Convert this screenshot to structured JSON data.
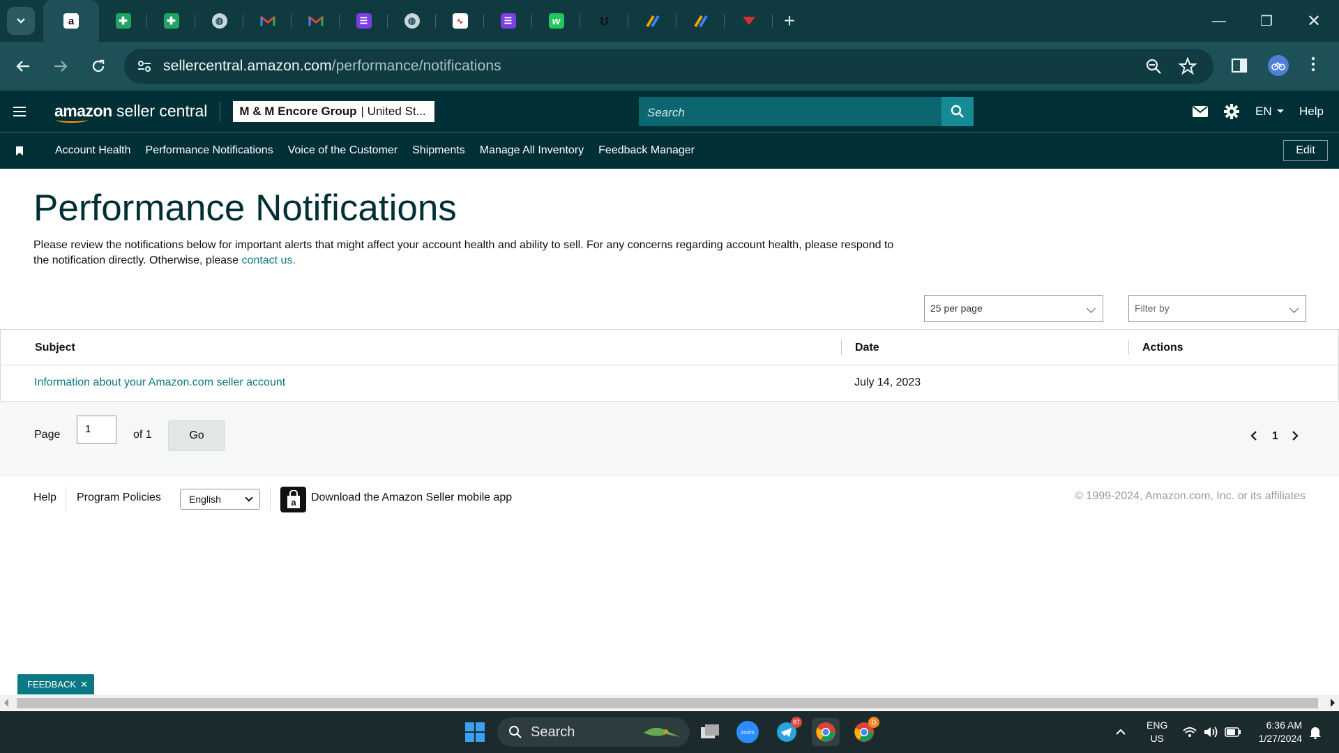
{
  "browser": {
    "tabs": [
      {
        "icon": "amazon-a-icon",
        "color": "#ffffff",
        "active": true
      },
      {
        "icon": "google-sheets-icon",
        "color": "#1fa463"
      },
      {
        "icon": "google-sheets-icon",
        "color": "#1fa463"
      },
      {
        "icon": "globe-icon",
        "color": "#c9d6d7"
      },
      {
        "icon": "gmail-icon",
        "color": "#ea4335"
      },
      {
        "icon": "gmail-icon",
        "color": "#ea4335"
      },
      {
        "icon": "list-doc-icon",
        "color": "#7b3fe4"
      },
      {
        "icon": "globe-icon",
        "color": "#c9d6d7"
      },
      {
        "icon": "chart-doc-icon",
        "color": "#ffffff"
      },
      {
        "icon": "list-doc-icon",
        "color": "#7b3fe4"
      },
      {
        "icon": "w-brand-icon",
        "color": "#22c55e"
      },
      {
        "icon": "u-brand-icon",
        "color": "#111111"
      },
      {
        "icon": "pencil-brand-icon",
        "color": "#f59e0b"
      },
      {
        "icon": "pencil-brand-icon",
        "color": "#f59e0b"
      },
      {
        "icon": "red-logo-icon",
        "color": "#d32f2f"
      }
    ],
    "url_host": "sellercentral.amazon.com",
    "url_path": "/performance/notifications"
  },
  "header": {
    "logo_brand": "amazon",
    "logo_product": " seller central",
    "account_name": "M & M Encore Group",
    "account_region": "| United St...",
    "search_placeholder": "Search",
    "language": "EN",
    "help": "Help"
  },
  "nav": {
    "links": [
      "Account Health",
      "Performance Notifications",
      "Voice of the Customer",
      "Shipments",
      "Manage All Inventory",
      "Feedback Manager"
    ],
    "edit": "Edit"
  },
  "page": {
    "title": "Performance Notifications",
    "description": "Please review the notifications below for important alerts that might affect your account health and ability to sell. For any concerns regarding account health, please respond to the notification directly. Otherwise, please ",
    "contact_link": "contact us.",
    "per_page": "25 per page",
    "filter_placeholder": "Filter by"
  },
  "table": {
    "columns": [
      "Subject",
      "Date",
      "Actions"
    ],
    "rows": [
      {
        "subject": "Information about your Amazon.com seller account",
        "date": "July 14, 2023",
        "actions": ""
      }
    ]
  },
  "pagination": {
    "page_label": "Page",
    "current_page": "1",
    "of_label": "of 1",
    "go": "Go",
    "page_number": "1"
  },
  "footer": {
    "help": "Help",
    "program_policies": "Program Policies",
    "language": "English",
    "app_link": "Download the Amazon Seller mobile app",
    "copyright": "© 1999-2024, Amazon.com, Inc. or its affiliates"
  },
  "feedback": {
    "label": "FEEDBACK"
  },
  "taskbar": {
    "search": "Search",
    "telegram_badge": "87",
    "chrome_badge": "D",
    "lang_top": "ENG",
    "lang_bottom": "US",
    "time": "6:36 AM",
    "date": "1/27/2024"
  },
  "colors": {
    "header_bg": "#002f36",
    "link": "#0b7985",
    "accent_orange": "#ff9900"
  }
}
